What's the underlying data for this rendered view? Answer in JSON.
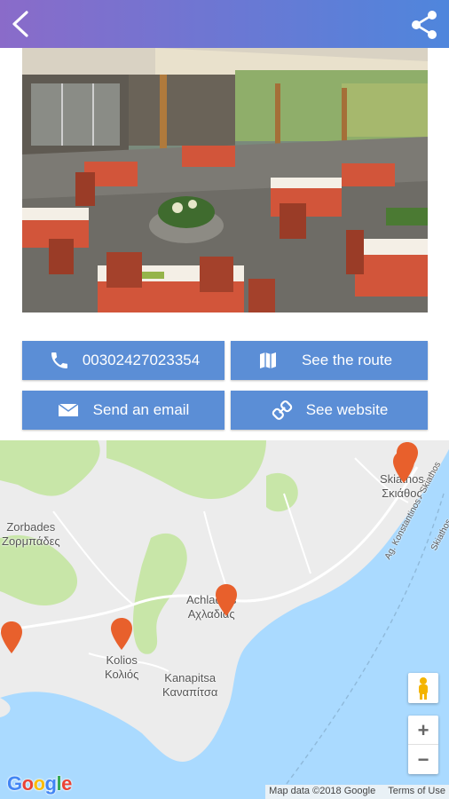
{
  "header": {
    "back_icon": "back-arrow-icon",
    "share_icon": "share-icon"
  },
  "actions": {
    "phone_label": "00302427023354",
    "route_label": "See the route",
    "email_label": "Send an email",
    "website_label": "See website"
  },
  "map": {
    "places": {
      "zorbades": "Zorbades\nΖορμπάδες",
      "skiathos": "Skiathos\nΣκιάθος",
      "achladias": "Achladias\nΑχλαδιάς",
      "kolios": "Kolios\nΚολιός",
      "kanapitsa": "Kanapitsa\nΚαναπίτσα"
    },
    "road_label": "Ag. Konstantinos - Skiathos",
    "road_label_2": "Skiathos - Volos",
    "zoom_in": "+",
    "zoom_out": "−",
    "logo": "Google",
    "attribution": "Map data ©2018 Google",
    "terms": "Terms of Use"
  },
  "colors": {
    "topbar_start": "#8a6bc9",
    "topbar_end": "#4f86dc",
    "button": "#5b8ed6",
    "pin": "#e8602c",
    "water": "#aadaff",
    "park": "#c8e6a8"
  }
}
